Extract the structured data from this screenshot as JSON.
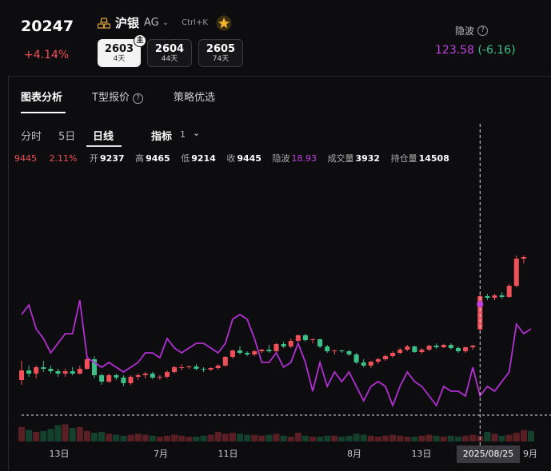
{
  "header": {
    "price": "20247",
    "change_pct": "+4.14%",
    "symbol_name": "沪银",
    "symbol_code": "AG",
    "shortcut": "Ctrl+K",
    "main_badge": "主",
    "contracts": [
      {
        "code": "2603",
        "days": "4天"
      },
      {
        "code": "2604",
        "days": "44天"
      },
      {
        "code": "2605",
        "days": "74天"
      }
    ],
    "iv_label": "隐波",
    "iv_value": "123.58",
    "iv_change": "(-6.16)"
  },
  "tabs": [
    {
      "label": "图表分析"
    },
    {
      "label": "T型报价"
    },
    {
      "label": "策略优选"
    }
  ],
  "periods": [
    "分时",
    "5日",
    "日线"
  ],
  "indicator": {
    "label": "指标",
    "count": "1"
  },
  "stats": {
    "price": "9445",
    "pct": "2.11%",
    "open_label": "开",
    "open": "9237",
    "high_label": "高",
    "high": "9465",
    "low_label": "低",
    "low": "9214",
    "close_label": "收",
    "close": "9445",
    "iv_label": "隐波",
    "iv": "18.93",
    "volume_label": "成交量",
    "volume": "3932",
    "oi_label": "持仓量",
    "oi": "14508"
  },
  "chart_data": {
    "type": "candlestick",
    "x_labels": [
      "13日",
      "7月",
      "11日",
      "8月",
      "13日",
      "9月"
    ],
    "crosshair_date": "2025/08/25",
    "colors": {
      "up": "#f0505a",
      "down": "#3cc08a",
      "iv_line": "#b030d0"
    },
    "candles": [
      [
        8920,
        9040,
        8890,
        8980
      ],
      [
        8980,
        9010,
        8940,
        8960
      ],
      [
        8960,
        9010,
        8930,
        9000
      ],
      [
        9000,
        9040,
        8970,
        8990
      ],
      [
        8990,
        9010,
        8960,
        8975
      ],
      [
        8975,
        8990,
        8940,
        8960
      ],
      [
        8960,
        8990,
        8940,
        8975
      ],
      [
        8975,
        9000,
        8950,
        8960
      ],
      [
        8960,
        9010,
        8955,
        8990
      ],
      [
        8990,
        9060,
        8985,
        9050
      ],
      [
        9050,
        9070,
        8930,
        8950
      ],
      [
        8950,
        8960,
        8890,
        8910
      ],
      [
        8910,
        8960,
        8900,
        8950
      ],
      [
        8950,
        8960,
        8920,
        8935
      ],
      [
        8935,
        8950,
        8880,
        8900
      ],
      [
        8900,
        8950,
        8890,
        8940
      ],
      [
        8940,
        8960,
        8920,
        8950
      ],
      [
        8950,
        8970,
        8930,
        8960
      ],
      [
        8960,
        8970,
        8925,
        8935
      ],
      [
        8935,
        8950,
        8920,
        8940
      ],
      [
        8940,
        8980,
        8930,
        8970
      ],
      [
        8970,
        9010,
        8960,
        9000
      ],
      [
        9000,
        9020,
        8980,
        9000
      ],
      [
        9000,
        9010,
        8990,
        9005
      ],
      [
        9005,
        9020,
        8980,
        8990
      ],
      [
        8990,
        9000,
        8970,
        8985
      ],
      [
        8985,
        9000,
        8975,
        8995
      ],
      [
        8995,
        9020,
        8985,
        9010
      ],
      [
        9010,
        9070,
        9005,
        9065
      ],
      [
        9065,
        9110,
        9055,
        9105
      ],
      [
        9105,
        9130,
        9080,
        9090
      ],
      [
        9090,
        9100,
        9070,
        9080
      ],
      [
        9080,
        9110,
        9070,
        9100
      ],
      [
        9100,
        9115,
        9090,
        9110
      ],
      [
        9110,
        9140,
        9090,
        9100
      ],
      [
        9100,
        9150,
        9095,
        9145
      ],
      [
        9145,
        9160,
        9120,
        9130
      ],
      [
        9130,
        9180,
        9120,
        9165
      ],
      [
        9165,
        9205,
        9160,
        9200
      ],
      [
        9200,
        9210,
        9160,
        9170
      ],
      [
        9170,
        9180,
        9150,
        9175
      ],
      [
        9175,
        9180,
        9120,
        9130
      ],
      [
        9130,
        9140,
        9090,
        9100
      ],
      [
        9100,
        9110,
        9080,
        9105
      ],
      [
        9105,
        9110,
        9090,
        9100
      ],
      [
        9100,
        9110,
        9070,
        9080
      ],
      [
        9080,
        9090,
        9020,
        9030
      ],
      [
        9030,
        9050,
        9000,
        9010
      ],
      [
        9010,
        9040,
        8995,
        9035
      ],
      [
        9035,
        9060,
        9020,
        9050
      ],
      [
        9050,
        9080,
        9040,
        9070
      ],
      [
        9070,
        9100,
        9060,
        9090
      ],
      [
        9090,
        9120,
        9080,
        9110
      ],
      [
        9110,
        9140,
        9100,
        9130
      ],
      [
        9130,
        9135,
        9090,
        9095
      ],
      [
        9095,
        9120,
        9085,
        9110
      ],
      [
        9110,
        9140,
        9100,
        9135
      ],
      [
        9135,
        9150,
        9115,
        9125
      ],
      [
        9125,
        9145,
        9120,
        9140
      ],
      [
        9140,
        9150,
        9110,
        9120
      ],
      [
        9120,
        9130,
        9090,
        9100
      ],
      [
        9100,
        9130,
        9090,
        9125
      ],
      [
        9125,
        9140,
        9110,
        9135
      ],
      [
        9237,
        9465,
        9214,
        9445
      ],
      [
        9445,
        9460,
        9420,
        9435
      ],
      [
        9435,
        9460,
        9420,
        9450
      ],
      [
        9450,
        9470,
        9430,
        9440
      ],
      [
        9440,
        9520,
        9435,
        9510
      ],
      [
        9510,
        9700,
        9500,
        9680
      ],
      [
        9680,
        9700,
        9650,
        9690
      ]
    ],
    "iv": [
      36,
      38,
      33,
      31,
      28,
      30,
      32,
      32,
      39,
      27,
      26,
      25,
      26,
      25,
      24,
      25,
      26,
      28,
      28,
      27,
      31,
      29,
      28,
      29,
      30,
      30,
      29,
      28,
      30,
      35,
      36,
      35,
      31,
      26,
      26,
      28,
      25,
      26,
      30,
      26,
      20,
      26,
      21,
      24,
      22,
      24,
      21,
      18,
      21,
      22,
      21,
      17,
      21,
      24,
      22,
      21,
      19,
      17,
      21,
      20,
      20,
      19,
      25,
      19,
      21,
      20,
      22,
      24,
      34,
      32,
      33
    ],
    "volume": [
      30,
      24,
      20,
      22,
      26,
      34,
      36,
      28,
      30,
      22,
      18,
      20,
      16,
      14,
      12,
      14,
      16,
      14,
      12,
      10,
      12,
      14,
      12,
      10,
      10,
      12,
      14,
      20,
      16,
      18,
      16,
      14,
      14,
      12,
      14,
      16,
      12,
      10,
      18,
      12,
      10,
      10,
      12,
      12,
      10,
      12,
      16,
      14,
      12,
      10,
      12,
      14,
      12,
      10,
      10,
      12,
      14,
      12,
      10,
      12,
      10,
      12,
      14,
      12,
      20,
      16,
      12,
      14,
      18,
      24,
      22
    ]
  }
}
